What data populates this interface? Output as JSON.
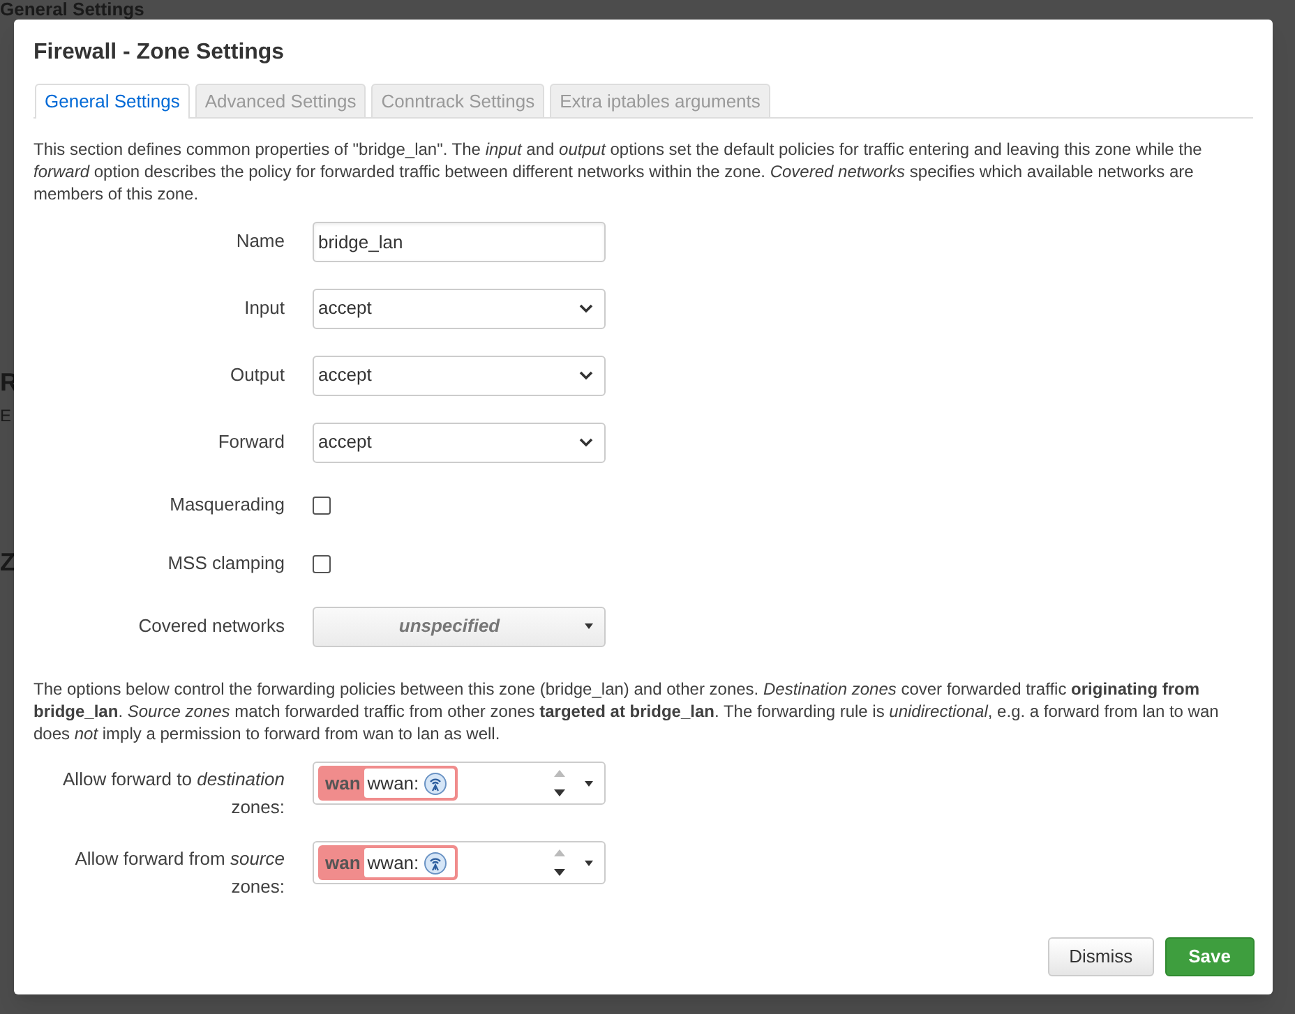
{
  "backdrop": {
    "heading": "General Settings",
    "fragments": [
      {
        "text": "R",
        "kind": "heading"
      },
      {
        "text": "E",
        "kind": "text"
      },
      {
        "text": "Z",
        "kind": "heading"
      }
    ]
  },
  "dialog": {
    "title": "Firewall - Zone Settings",
    "tabs": [
      {
        "label": "General Settings",
        "selected": true
      },
      {
        "label": "Advanced Settings",
        "selected": false
      },
      {
        "label": "Conntrack Settings",
        "selected": false
      },
      {
        "label": "Extra iptables arguments",
        "selected": false
      }
    ],
    "intro": "This section defines common properties of \"bridge_lan\". The *input* and *output* options set the default policies for traffic entering and leaving this zone while the *forward* option describes the policy for forwarded traffic between different networks within the zone. *Covered networks* specifies which available networks are members of this zone.",
    "fields": [
      {
        "kind": "text",
        "label": "Name",
        "value": "bridge_lan"
      },
      {
        "kind": "select",
        "label": "Input",
        "value": "accept"
      },
      {
        "kind": "select",
        "label": "Output",
        "value": "accept"
      },
      {
        "kind": "select",
        "label": "Forward",
        "value": "accept"
      },
      {
        "kind": "checkbox",
        "label": "Masquerading",
        "checked": false
      },
      {
        "kind": "checkbox",
        "label": "MSS clamping",
        "checked": false
      },
      {
        "kind": "dropdown",
        "label": "Covered networks",
        "value": "unspecified"
      }
    ],
    "forwarding_note": "The options below control the forwarding policies between this zone (bridge_lan) and other zones. *Destination zones* cover forwarded traffic **originating from bridge_lan**. *Source zones* match forwarded traffic from other zones **targeted at bridge_lan**. The forwarding rule is *unidirectional*, e.g. a forward from lan to wan does *not* imply a permission to forward from wan to lan as well.",
    "zone_fields": [
      {
        "label": "Allow forward to *destination* zones:",
        "zones": [
          {
            "name": "wan",
            "network": "wwan:",
            "color": "#f08c8c"
          }
        ]
      },
      {
        "label": "Allow forward from *source* zones:",
        "zones": [
          {
            "name": "wan",
            "network": "wwan:",
            "color": "#f08c8c"
          }
        ]
      }
    ],
    "buttons": [
      {
        "kind": "default",
        "label": "Dismiss"
      },
      {
        "kind": "primary",
        "label": "Save"
      }
    ]
  }
}
